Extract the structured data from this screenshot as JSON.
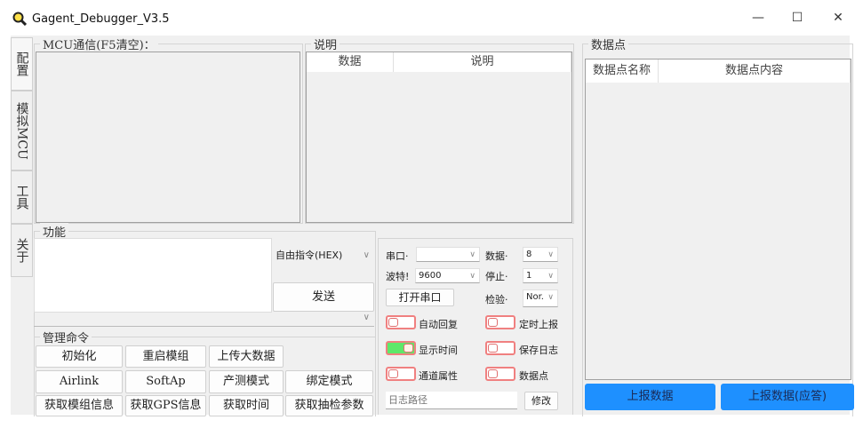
{
  "window": {
    "title": "Gagent_Debugger_V3.5",
    "minimize": "—",
    "maximize": "☐",
    "close": "✕"
  },
  "side_tabs": [
    "配置",
    "模拟MCU",
    "工具",
    "关于"
  ],
  "mcu": {
    "group_label": "MCU通信(F5清空)："
  },
  "desc": {
    "group_label": "说明",
    "columns": [
      "数据",
      "说明"
    ]
  },
  "func": {
    "group_label": "功能",
    "command_type": "自由指令(HEX)",
    "send_label": "发送"
  },
  "mgmt": {
    "group_label": "管理命令",
    "buttons": [
      "初始化",
      "重启模组",
      "上传大数据",
      "Airlink",
      "SoftAp",
      "产测模式",
      "绑定模式",
      "获取模组信息",
      "获取GPS信息",
      "获取时间",
      "获取抽检参数"
    ]
  },
  "serial": {
    "port_label": "串口·",
    "port_value": "",
    "data_label": "数据·",
    "data_value": "8",
    "baud_label": "波特!",
    "baud_value": "9600",
    "stop_label": "停止·",
    "stop_value": "1",
    "open_label": "打开串口",
    "parity_label": "检验·",
    "parity_value": "Nor.",
    "toggles": [
      {
        "label": "自动回复",
        "on": false
      },
      {
        "label": "定时上报",
        "on": false
      },
      {
        "label": "显示时间",
        "on": true
      },
      {
        "label": "保存日志",
        "on": false
      },
      {
        "label": "通道属性",
        "on": false
      },
      {
        "label": "数据点",
        "on": false
      }
    ],
    "log_path_placeholder": "日志路径",
    "modify_label": "修改"
  },
  "datapoints": {
    "group_label": "数据点",
    "columns": [
      "数据点名称",
      "数据点内容"
    ],
    "report_label": "上报数据",
    "report_ack_label": "上报数据(应答)"
  }
}
